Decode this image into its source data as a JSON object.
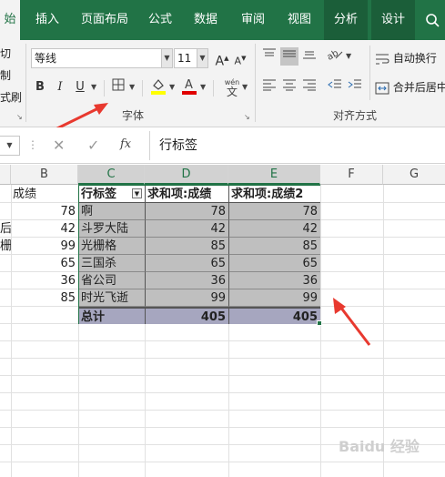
{
  "ribbon_tabs": [
    "始",
    "插入",
    "页面布局",
    "公式",
    "数据",
    "审阅",
    "视图",
    "分析",
    "设计"
  ],
  "ribbon": {
    "font_name": "等线",
    "font_size": "11",
    "increase_font": "A",
    "decrease_font": "A",
    "bold": "B",
    "italic": "I",
    "underline": "U",
    "phonetic": "wén",
    "font_group_label": "字体",
    "align_group_label": "对齐方式",
    "wrap_text": "自动换行",
    "merge_center": "合并后居中",
    "left_partial": [
      "切",
      "制",
      "式刷"
    ]
  },
  "formula_bar": {
    "fx": "fx",
    "value": "行标签"
  },
  "columns": [
    "B",
    "C",
    "D",
    "E",
    "F",
    "G"
  ],
  "colB": {
    "header": "成绩",
    "values": [
      "78",
      "42",
      "99",
      "65",
      "36",
      "85"
    ]
  },
  "colA_partial": [
    "后",
    "栅"
  ],
  "pivot": {
    "headers": [
      "行标签",
      "求和项:成绩",
      "求和项:成绩2"
    ],
    "rows": [
      {
        "label": "啊",
        "v1": "78",
        "v2": "78"
      },
      {
        "label": "斗罗大陆",
        "v1": "42",
        "v2": "42"
      },
      {
        "label": "光栅格",
        "v1": "85",
        "v2": "85"
      },
      {
        "label": "三国杀",
        "v1": "65",
        "v2": "65"
      },
      {
        "label": "省公司",
        "v1": "36",
        "v2": "36"
      },
      {
        "label": "时光飞逝",
        "v1": "99",
        "v2": "99"
      }
    ],
    "total": {
      "label": "总计",
      "v1": "405",
      "v2": "405"
    }
  },
  "watermark": "Baidu 经验",
  "colors": {
    "excel_green": "#217346",
    "arrow_red": "#e8392f",
    "pivot_fill": "#bfbfbf",
    "total_fill": "#a6a6bf"
  }
}
